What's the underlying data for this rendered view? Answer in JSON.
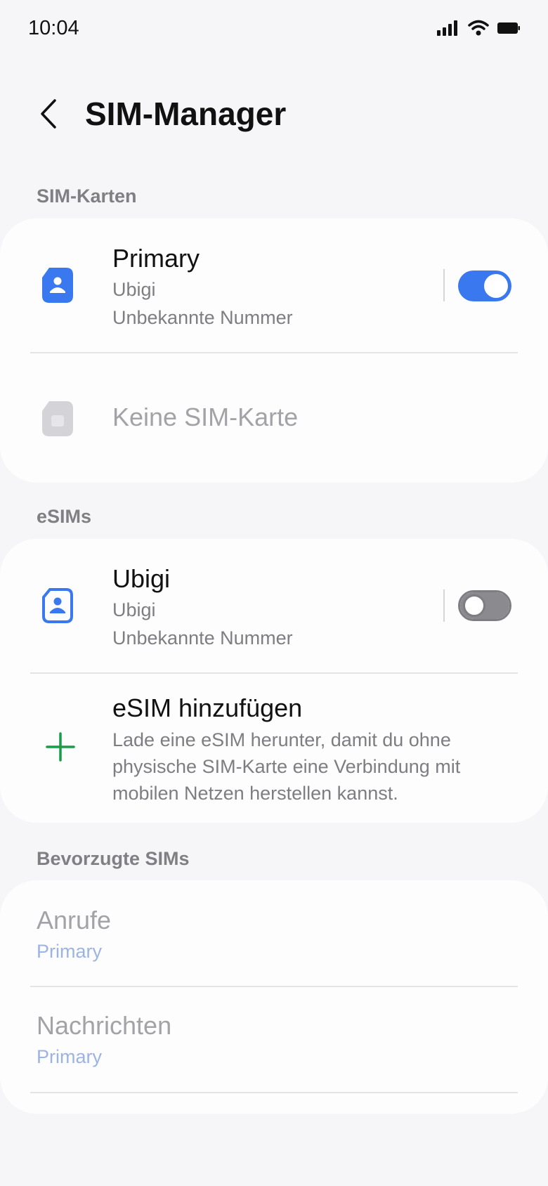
{
  "status_bar": {
    "time": "10:04"
  },
  "header": {
    "title": "SIM-Manager"
  },
  "sections": {
    "sim_cards": {
      "label": "SIM-Karten",
      "primary": {
        "title": "Primary",
        "carrier": "Ubigi",
        "number": "Unbekannte Nummer",
        "enabled": true
      },
      "empty_slot": {
        "title": "Keine SIM-Karte"
      }
    },
    "esims": {
      "label": "eSIMs",
      "ubigi": {
        "title": "Ubigi",
        "carrier": "Ubigi",
        "number": "Unbekannte Nummer",
        "enabled": false
      },
      "add": {
        "title": "eSIM hinzufügen",
        "line1": "Lade eine eSIM herunter, damit du ohne",
        "line2": "physische SIM-Karte eine Verbindung mit",
        "line3": "mobilen Netzen herstellen kannst."
      }
    },
    "preferred": {
      "label": "Bevorzugte SIMs",
      "calls": {
        "title": "Anrufe",
        "value": "Primary"
      },
      "messages": {
        "title": "Nachrichten",
        "value": "Primary"
      }
    }
  },
  "colors": {
    "accent": "#3a78f0",
    "add_icon": "#1a9b49",
    "link": "#9cb4e4"
  }
}
